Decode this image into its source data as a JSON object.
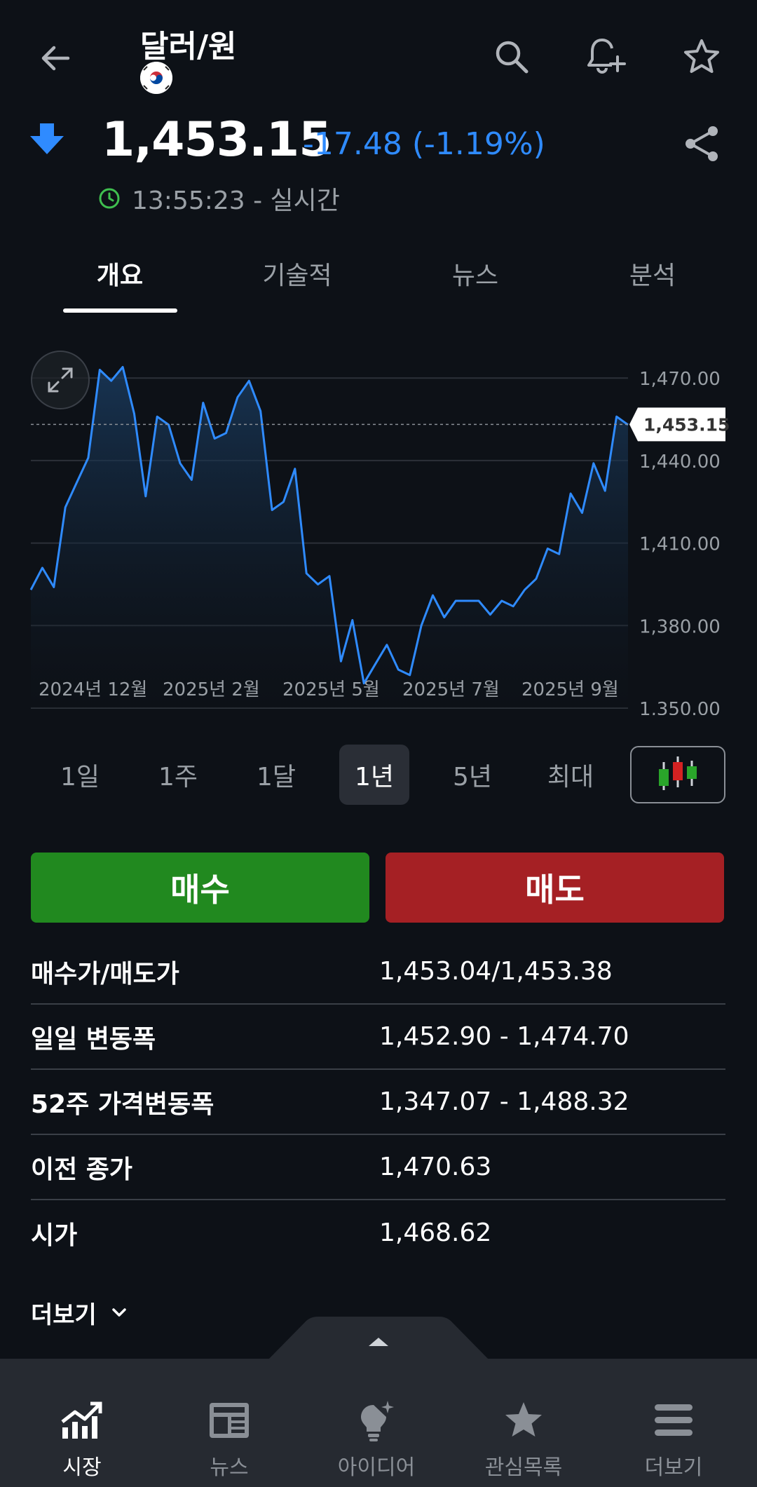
{
  "header": {
    "title": "달러/원"
  },
  "quote": {
    "price": "1,453.15",
    "change": "-17.48 (-1.19%)",
    "time": "13:55:23 - 실시간"
  },
  "tabs": [
    {
      "label": "개요"
    },
    {
      "label": "기술적"
    },
    {
      "label": "뉴스"
    },
    {
      "label": "분석"
    }
  ],
  "colors": {
    "line": "#2f8bff",
    "buy": "#21891f",
    "sell": "#a52024",
    "change_down": "#2f8bff"
  },
  "chart_data": {
    "type": "area",
    "y_ticks": [
      "1,470.00",
      "1,440.00",
      "1,410.00",
      "1,380.00",
      "1,350.00"
    ],
    "x_ticks": [
      "2024년 12월",
      "2025년 2월",
      "2025년 5월",
      "2025년 7월",
      "2025년 9월"
    ],
    "ylim": [
      1350,
      1480
    ],
    "current_label": "1,453.15",
    "current_value": 1453.15,
    "values": [
      1393,
      1401,
      1394,
      1423,
      1432,
      1441,
      1473,
      1469,
      1474,
      1457,
      1427,
      1456,
      1453,
      1439,
      1433,
      1461,
      1448,
      1450,
      1463,
      1469,
      1458,
      1422,
      1425,
      1437,
      1399,
      1395,
      1398,
      1367,
      1382,
      1359,
      1366,
      1373,
      1364,
      1362,
      1380,
      1391,
      1383,
      1389,
      1389,
      1389,
      1384,
      1389,
      1387,
      1393,
      1397,
      1408,
      1406,
      1428,
      1421,
      1439,
      1429,
      1456,
      1453
    ]
  },
  "ranges": [
    {
      "label": "1일"
    },
    {
      "label": "1주"
    },
    {
      "label": "1달"
    },
    {
      "label": "1년"
    },
    {
      "label": "5년"
    },
    {
      "label": "최대"
    }
  ],
  "actions": {
    "buy": "매수",
    "sell": "매도"
  },
  "stats": [
    {
      "label": "매수가/매도가",
      "value": "1,453.04/1,453.38"
    },
    {
      "label": "일일 변동폭",
      "value": "1,452.90 - 1,474.70"
    },
    {
      "label": "52주 가격변동폭",
      "value": "1,347.07 - 1,488.32"
    },
    {
      "label": "이전 종가",
      "value": "1,470.63"
    },
    {
      "label": "시가",
      "value": "1,468.62"
    }
  ],
  "more": "더보기",
  "nav": [
    {
      "label": "시장"
    },
    {
      "label": "뉴스"
    },
    {
      "label": "아이디어"
    },
    {
      "label": "관심목록"
    },
    {
      "label": "더보기"
    }
  ]
}
